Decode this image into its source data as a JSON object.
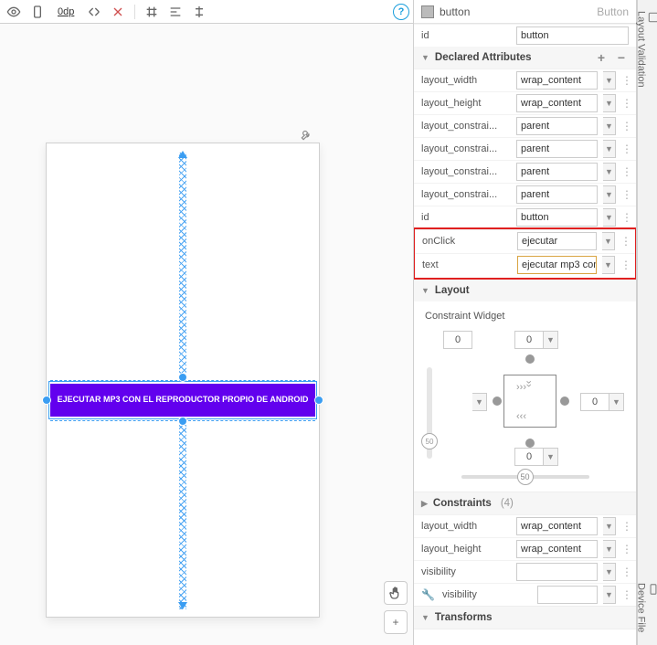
{
  "toolbar": {
    "zoom": "0dp"
  },
  "canvas": {
    "button_text": "EJECUTAR MP3 CON EL REPRODUCTOR PROPIO DE ANDROID"
  },
  "props": {
    "title_name": "button",
    "title_type": "Button",
    "id_row": {
      "label": "id",
      "value": "button"
    },
    "sections": {
      "declared": "Declared Attributes",
      "layout": "Layout",
      "constraints": "Constraints",
      "constraints_count": "(4)",
      "transforms": "Transforms"
    },
    "declared": [
      {
        "label": "layout_width",
        "value": "wrap_content"
      },
      {
        "label": "layout_height",
        "value": "wrap_content"
      },
      {
        "label": "layout_constrai...",
        "value": "parent"
      },
      {
        "label": "layout_constrai...",
        "value": "parent"
      },
      {
        "label": "layout_constrai...",
        "value": "parent"
      },
      {
        "label": "layout_constrai...",
        "value": "parent"
      },
      {
        "label": "id",
        "value": "button"
      },
      {
        "label": "onClick",
        "value": "ejecutar"
      },
      {
        "label": "text",
        "value": "ejecutar mp3 con el reproductor propio de android"
      }
    ],
    "cw_label": "Constraint Widget",
    "cw": {
      "top": "0",
      "left": "0",
      "right": "0",
      "bottom": "0",
      "hbias": "50",
      "vbias": "50"
    },
    "layout_rows": [
      {
        "label": "layout_width",
        "value": "wrap_content"
      },
      {
        "label": "layout_height",
        "value": "wrap_content"
      },
      {
        "label": "visibility",
        "value": ""
      },
      {
        "label": "visibility",
        "value": "",
        "wrench": true
      }
    ]
  },
  "vtabs": {
    "a": "Layout Validation",
    "b": "Device File"
  }
}
